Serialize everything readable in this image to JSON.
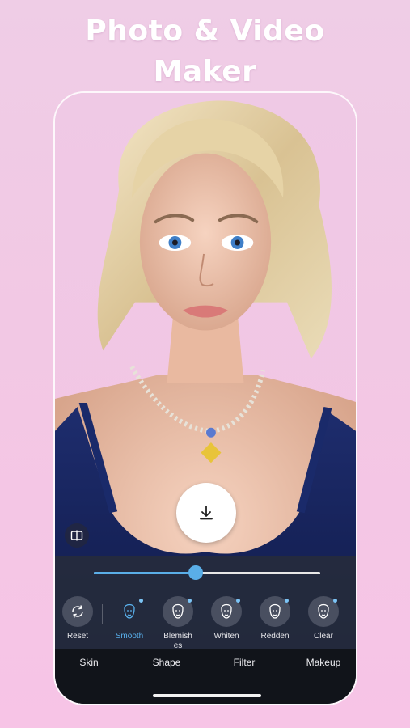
{
  "headline": {
    "line1": "Photo & Video",
    "line2": "Maker"
  },
  "colors": {
    "accent": "#5aaee8",
    "panel": "#262c3a",
    "tabbar": "#11141a"
  },
  "editor": {
    "compare_icon": "compare-icon",
    "download_icon": "download-icon",
    "slider_value": 0.45
  },
  "tools": [
    {
      "label": "Reset",
      "icon": "reset-icon"
    },
    {
      "label": "Smooth",
      "icon": "face-smooth-icon"
    },
    {
      "label": "Blemishes",
      "icon": "face-blemish-icon"
    },
    {
      "label": "Whiten",
      "icon": "face-whiten-icon"
    },
    {
      "label": "Redden",
      "icon": "face-redden-icon"
    },
    {
      "label": "Clear",
      "icon": "face-clear-icon"
    }
  ],
  "tabs": [
    {
      "label": "Skin"
    },
    {
      "label": "Shape"
    },
    {
      "label": "Filter"
    },
    {
      "label": "Makeup"
    }
  ]
}
